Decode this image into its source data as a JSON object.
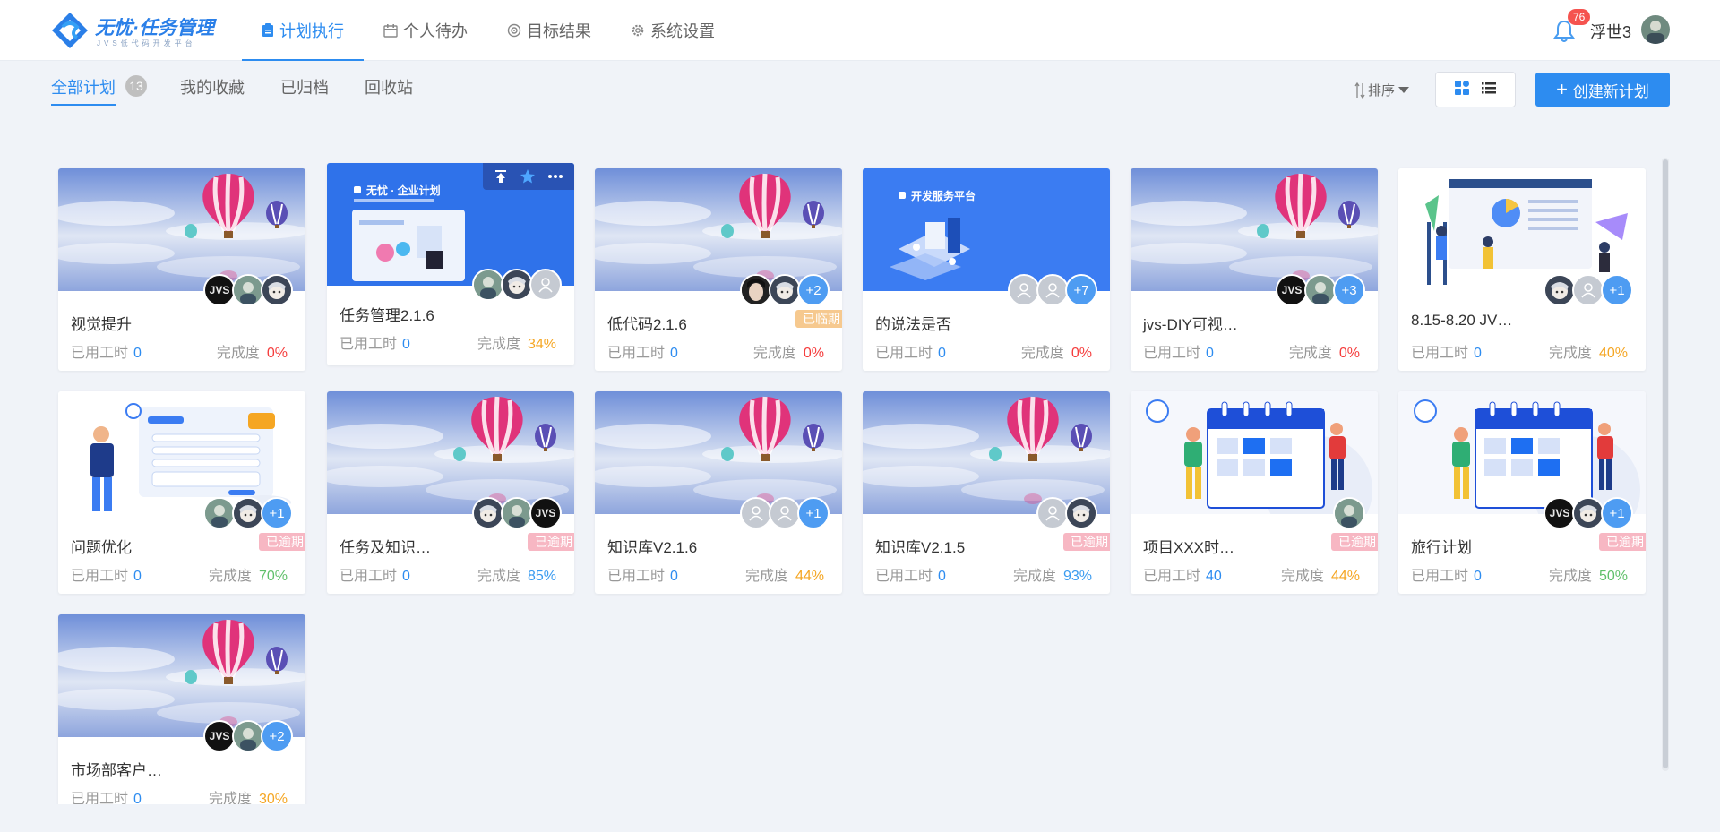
{
  "app": {
    "logo_title": "无忧·任务管理",
    "logo_sub": "JVS低代码开发平台"
  },
  "nav": [
    {
      "label": "计划执行",
      "icon": "clipboard-icon",
      "active": true
    },
    {
      "label": "个人待办",
      "icon": "calendar-icon"
    },
    {
      "label": "目标结果",
      "icon": "target-icon"
    },
    {
      "label": "系统设置",
      "icon": "gear-icon"
    }
  ],
  "user": {
    "name": "浮世3",
    "notifications": "76"
  },
  "subtabs": [
    {
      "label": "全部计划",
      "active": true
    },
    {
      "label": "我的收藏"
    },
    {
      "label": "已归档"
    },
    {
      "label": "回收站"
    }
  ],
  "plan_count": "13",
  "toolbar": {
    "sort_label": "排序",
    "create_label": "创建新计划"
  },
  "labels": {
    "hours": "已用工时",
    "progress": "完成度"
  },
  "cards": [
    {
      "name": "视觉提升",
      "hours": "0",
      "progress": "0%",
      "pclass": "red",
      "cover": "balloon",
      "status": "",
      "avatars": [
        "jvs",
        "photo",
        "anime"
      ]
    },
    {
      "name": "任务管理2.1.6",
      "hours": "0",
      "progress": "34%",
      "pclass": "orange",
      "cover": "enterprise",
      "status": "",
      "avatars": [
        "photo",
        "anime",
        "person"
      ],
      "cover_title": "无忧 · 企业计划"
    },
    {
      "name": "低代码2.1.6",
      "hours": "0",
      "progress": "0%",
      "pclass": "red",
      "cover": "balloon",
      "status": "已临期",
      "scls": "due",
      "avatars": [
        "dark",
        "anime",
        "+2"
      ]
    },
    {
      "name": "的说法是否",
      "hours": "0",
      "progress": "0%",
      "pclass": "red",
      "cover": "devplat",
      "status": "",
      "avatars": [
        "person",
        "person",
        "+7"
      ],
      "cover_title": "开发服务平台"
    },
    {
      "name": "jvs-DIY可视…",
      "hours": "0",
      "progress": "0%",
      "pclass": "red",
      "cover": "balloon",
      "status": "",
      "avatars": [
        "jvs",
        "photo",
        "+3"
      ]
    },
    {
      "name": "8.15-8.20 JV…",
      "hours": "0",
      "progress": "40%",
      "pclass": "orange",
      "cover": "people",
      "status": "",
      "avatars": [
        "anime",
        "person",
        "+1"
      ]
    },
    {
      "name": "问题优化",
      "hours": "0",
      "progress": "70%",
      "pclass": "green",
      "cover": "form",
      "status": "已逾期",
      "scls": "overdue",
      "avatars": [
        "photo",
        "anime",
        "+1"
      ]
    },
    {
      "name": "任务及知识…",
      "hours": "0",
      "progress": "85%",
      "pclass": "blue",
      "cover": "balloon",
      "status": "已逾期",
      "scls": "overdue",
      "avatars": [
        "anime",
        "photo",
        "jvs"
      ]
    },
    {
      "name": "知识库V2.1.6",
      "hours": "0",
      "progress": "44%",
      "pclass": "orange",
      "cover": "balloon",
      "status": "",
      "avatars": [
        "person",
        "person",
        "+1"
      ]
    },
    {
      "name": "知识库V2.1.5",
      "hours": "0",
      "progress": "93%",
      "pclass": "blue",
      "cover": "balloon",
      "status": "已逾期",
      "scls": "overdue",
      "avatars": [
        "person",
        "anime"
      ]
    },
    {
      "name": "项目XXX时…",
      "hours": "40",
      "progress": "44%",
      "pclass": "orange",
      "cover": "calendar",
      "status": "已逾期",
      "scls": "overdue",
      "avatars": [
        "photo"
      ]
    },
    {
      "name": "旅行计划",
      "hours": "0",
      "progress": "50%",
      "pclass": "green",
      "cover": "calendar",
      "status": "已逾期",
      "scls": "overdue",
      "avatars": [
        "jvs",
        "anime",
        "+1"
      ]
    },
    {
      "name": "市场部客户…",
      "hours": "0",
      "progress": "30%",
      "pclass": "orange",
      "cover": "balloon",
      "status": "",
      "avatars": [
        "jvs",
        "photo",
        "+2"
      ]
    }
  ],
  "colors": {
    "accent": "#2d8cf0",
    "bg": "#f0f3f8",
    "overdue": "#f7b7c3",
    "due": "#f6c98f"
  }
}
